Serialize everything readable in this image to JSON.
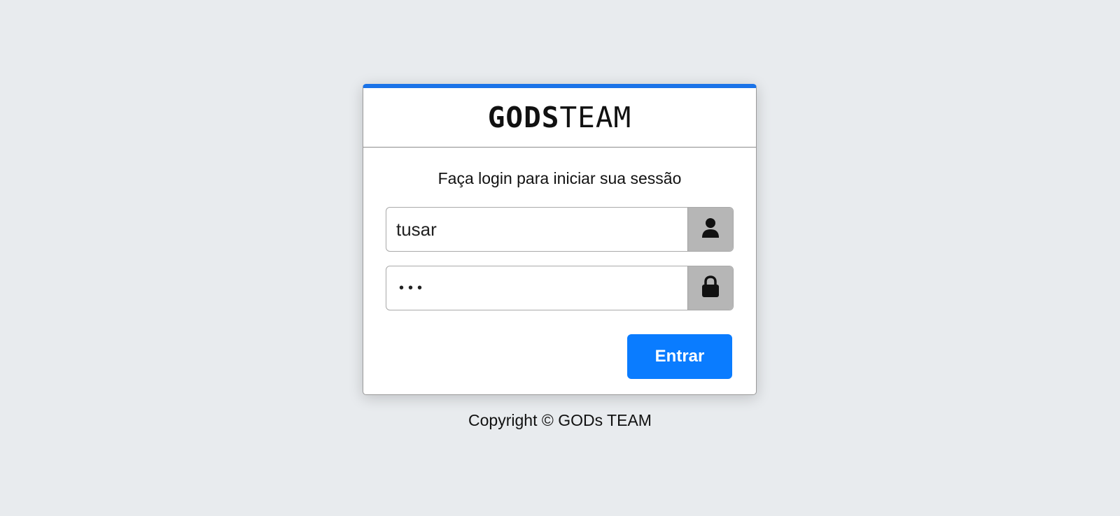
{
  "brand": {
    "strong": "GODS",
    "light": "TEAM"
  },
  "login": {
    "subtitle": "Faça login para iniciar sua sessão",
    "username_value": "tusar",
    "password_mask": "•••",
    "submit_label": "Entrar",
    "icons": {
      "username": "user-icon",
      "password": "lock-icon"
    }
  },
  "footer": {
    "copyright": "Copyright © GODs TEAM"
  },
  "colors": {
    "accent": "#1a73e8",
    "button": "#0a7cff",
    "background": "#e8ebee",
    "addon": "#b6b6b6"
  }
}
